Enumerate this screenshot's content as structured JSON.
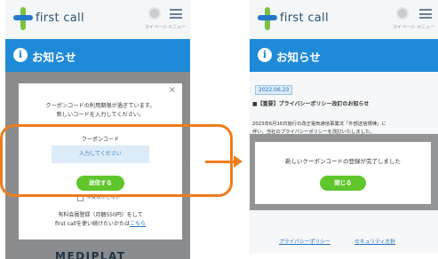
{
  "left": {
    "header": {
      "logo_text": "first call",
      "mypage_caption": "マイページ",
      "menu_caption": "メニュー"
    },
    "band_title": "お知らせ",
    "modal": {
      "close_symbol": "×",
      "message_line1": "クーポンコードの利用期限が過ぎています。",
      "message_line2": "新しいコードを入力してください。",
      "field_label": "クーポンコード",
      "field_placeholder": "入力してください",
      "submit_label": "送信する",
      "checkbox_label": "今後表示しない",
      "promo_line1": "有料会員登録（月額550円）をして",
      "promo_line2_prefix": "first callを使い続けたいかたは",
      "promo_link": "こちら"
    },
    "footer_logo": "MEDIPLAT"
  },
  "right": {
    "header": {
      "logo_text": "first call",
      "mypage_caption": "マイページ",
      "menu_caption": "メニュー"
    },
    "band_title": "お知らせ",
    "date_badge": "2022.06.23",
    "notice_title": "■【重要】プライバシーポリシー改訂のお知らせ",
    "notice_body_line1": "2023年6月16日施行の改正電気通信事業法「外部送信規律」に",
    "notice_body_line2": "伴い、当社のプライバシーポリシーを改訂いたしました。",
    "modal": {
      "message": "新しいクーポンコードの登録が完了しました",
      "close_label": "閉じる"
    },
    "footer_links": [
      "プライバシーポリシー",
      "セキュリティ方針"
    ]
  },
  "colors": {
    "brand_blue": "#1f8ad7",
    "button_green": "#5fc62c",
    "highlight_orange": "#ee7d1b",
    "logo_green": "#7cc242",
    "logo_blue": "#2479c9"
  }
}
